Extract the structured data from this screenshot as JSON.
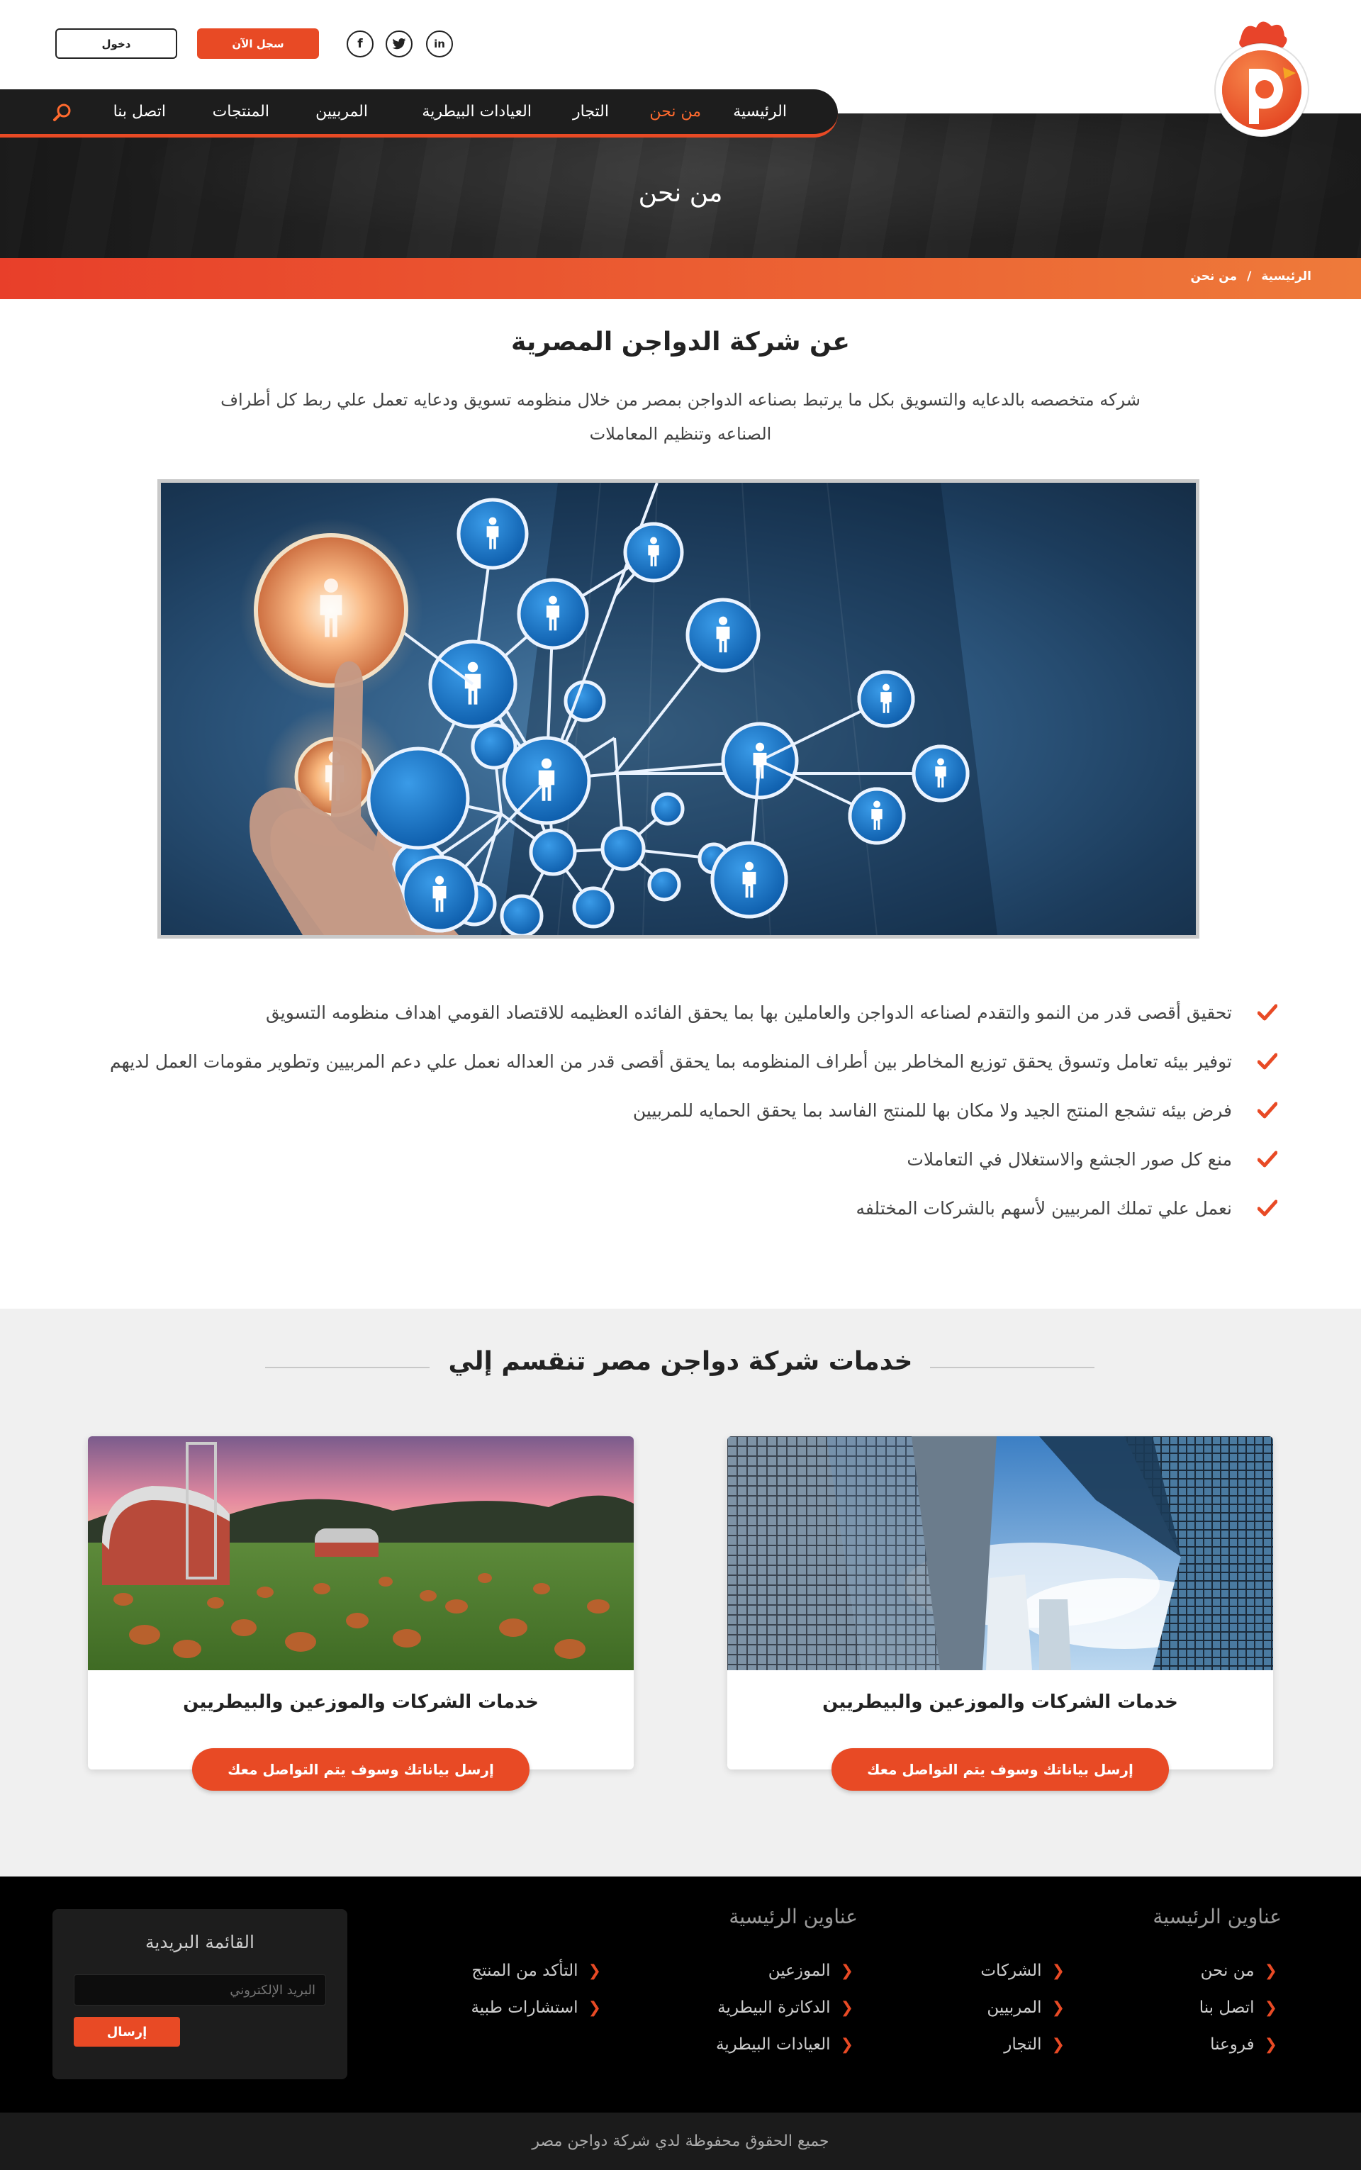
{
  "header": {
    "login_label": "دخول",
    "register_label": "سجل الآن",
    "social": [
      {
        "name": "facebook-icon",
        "glyph": "f"
      },
      {
        "name": "twitter-icon",
        "glyph": "t"
      },
      {
        "name": "linkedin-icon",
        "glyph": "in"
      }
    ],
    "logo_letter": "P"
  },
  "nav": {
    "items": [
      "الرئيسية",
      "من نحن",
      "التجار",
      "العيادات البيطرية",
      "المربيين",
      "المنتجات",
      "اتصل بنا"
    ],
    "active_index": 1
  },
  "hero": {
    "title": "من نحن",
    "breadcrumb": [
      "الرئيسية",
      "/",
      "من نحن"
    ]
  },
  "about": {
    "title": "عن شركة الدواجن المصرية",
    "description": "شركه متخصصه بالدعايه والتسويق بكل ما يرتبط بصناعه الدواجن بمصر من خلال منظومه تسويق ودعايه تعمل علي ربط كل أطراف الصناعه وتنظيم المعاملات",
    "features": [
      "تحقيق أقصى قدر من النمو والتقدم لصناعه الدواجن والعاملين بها بما يحقق الفائده العظيمه للاقتصاد القومي اهداف منظومه التسويق",
      "توفير بيئه تعامل وتسوق يحقق توزيع المخاطر بين أطراف المنظومه بما يحقق أقصى قدر من العداله  نعمل علي دعم المربيين وتطوير مقومات العمل لديهم",
      "فرض بيئه تشجع المنتج الجيد ولا مكان بها للمنتج الفاسد بما يحقق الحمايه للمربيين",
      "منع كل صور الجشع والاستغلال في التعاملات",
      "نعمل علي تملك المربيين لأسهم بالشركات المختلفه"
    ]
  },
  "services": {
    "title": "خدمات شركة دواجن مصر تنقسم إلي",
    "cards": [
      {
        "title": "خدمات الشركات والموزعين والبيطريين",
        "button": "إرسل بياناتك وسوف يتم التواصل معك"
      },
      {
        "title": "خدمات الشركات والموزعين والبيطريين",
        "button": "إرسل بياناتك وسوف يتم التواصل معك"
      }
    ]
  },
  "footer": {
    "col1_title": "عناوين الرئيسية",
    "col2_title": "عناوين الرئيسية",
    "col1_a": [
      "من نحن",
      "اتصل بنا",
      "فروعنا"
    ],
    "col1_b": [
      "الشركات",
      "المربيين",
      "التجار"
    ],
    "col2_a": [
      "الموزعين",
      "الدكاترة البيطرية",
      "العيادات البيطرية"
    ],
    "col2_b": [
      "التأكد من المنتج",
      "استشارات طبية"
    ],
    "newsletter": {
      "title": "القائمة البريدية",
      "placeholder": "البريد الإلكتروني",
      "button": "إرسال"
    },
    "copyright": "جميع الحقوق محفوظة لدي شركة دواجن مصر"
  },
  "colors": {
    "accent": "#e84a25",
    "dark": "#1d1d1d",
    "gradient_start": "#e83f2a",
    "gradient_end": "#ee7a3a"
  }
}
